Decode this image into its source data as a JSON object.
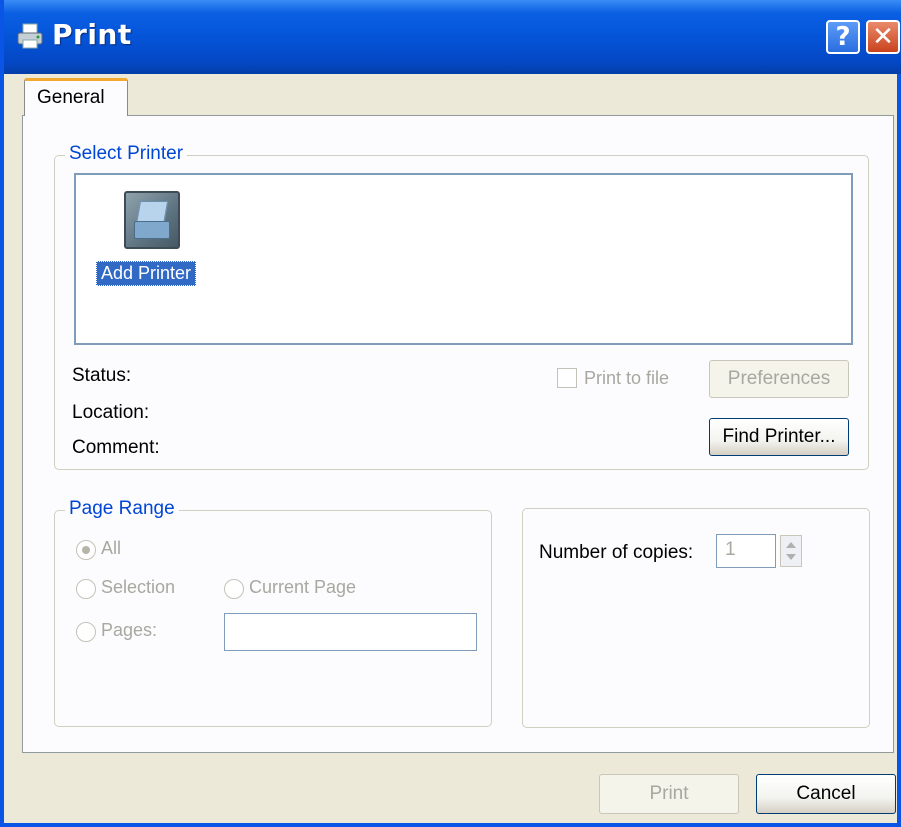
{
  "window": {
    "title": "Print",
    "help_label": "?",
    "close_label": "✕"
  },
  "tabs": [
    {
      "label": "General",
      "active": true
    }
  ],
  "select_printer": {
    "group_label": "Select Printer",
    "printers": [
      {
        "name": "Add Printer",
        "selected": true,
        "icon": "add-printer-icon"
      }
    ],
    "status_label": "Status:",
    "location_label": "Location:",
    "comment_label": "Comment:",
    "print_to_file_label": "Print to file",
    "print_to_file_checked": false,
    "preferences_label": "Preferences",
    "find_printer_label": "Find Printer..."
  },
  "page_range": {
    "group_label": "Page Range",
    "all_label": "All",
    "selection_label": "Selection",
    "current_page_label": "Current Page",
    "pages_label": "Pages:",
    "pages_value": "",
    "selected": "All"
  },
  "copies": {
    "label": "Number of copies:",
    "value": "1"
  },
  "footer": {
    "print_label": "Print",
    "cancel_label": "Cancel"
  },
  "colors": {
    "titlebar": "#0554d8",
    "group_label": "#0046d5",
    "selection": "#316ac5",
    "tab_accent": "#f2a931"
  }
}
